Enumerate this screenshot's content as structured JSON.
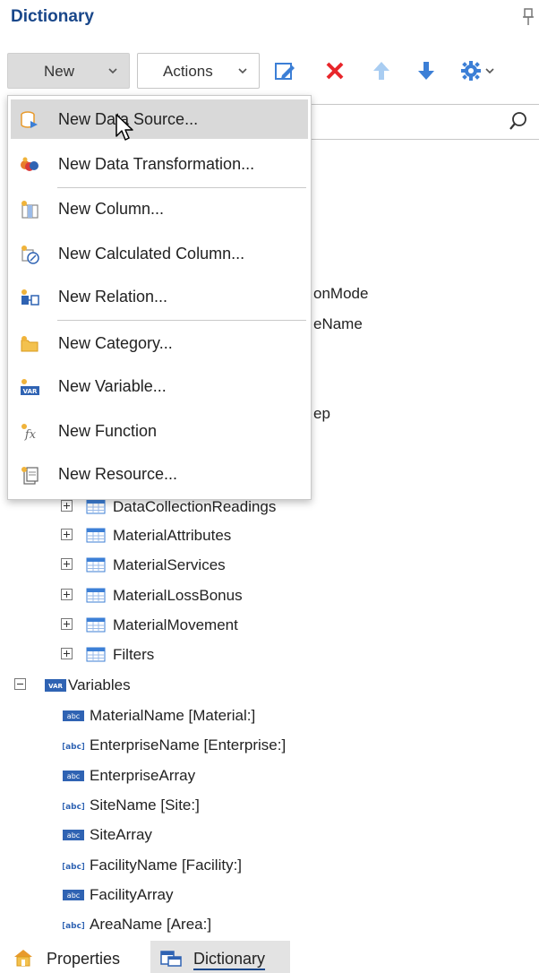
{
  "panel": {
    "title": "Dictionary"
  },
  "toolbar": {
    "new_label": "New",
    "actions_label": "Actions",
    "icons": [
      "edit-icon",
      "delete-icon",
      "move-up-icon",
      "move-down-icon",
      "settings-icon"
    ]
  },
  "menu": {
    "items": [
      {
        "label": "New Data Source...",
        "icon": "data-source-icon"
      },
      {
        "label": "New Data Transformation...",
        "icon": "data-transformation-icon"
      },
      {
        "label": "New Column...",
        "icon": "column-icon"
      },
      {
        "label": "New Calculated Column...",
        "icon": "calculated-column-icon"
      },
      {
        "label": "New Relation...",
        "icon": "relation-icon"
      },
      {
        "label": "New Category...",
        "icon": "category-icon"
      },
      {
        "label": "New Variable...",
        "icon": "variable-icon"
      },
      {
        "label": "New Function",
        "icon": "function-icon"
      },
      {
        "label": "New Resource...",
        "icon": "resource-icon"
      }
    ]
  },
  "tree": {
    "hidden_partials": [
      "onMode",
      "eName",
      "ep"
    ],
    "datasources": [
      "DataCollectionReadings",
      "MaterialAttributes",
      "MaterialServices",
      "MaterialLossBonus",
      "MaterialMovement",
      "Filters"
    ],
    "variables_label": "Variables",
    "variables": [
      {
        "label": "MaterialName [Material:]",
        "kind": "abc-array"
      },
      {
        "label": "EnterpriseName [Enterprise:]",
        "kind": "abc"
      },
      {
        "label": "EnterpriseArray",
        "kind": "abc-array"
      },
      {
        "label": "SiteName [Site:]",
        "kind": "abc"
      },
      {
        "label": "SiteArray",
        "kind": "abc-array"
      },
      {
        "label": "FacilityName [Facility:]",
        "kind": "abc"
      },
      {
        "label": "FacilityArray",
        "kind": "abc-array"
      },
      {
        "label": "AreaName [Area:]",
        "kind": "abc"
      }
    ]
  },
  "tabs": [
    {
      "label": "Properties",
      "icon": "properties-icon"
    },
    {
      "label": "Dictionary",
      "icon": "dictionary-icon",
      "active": true
    }
  ],
  "colors": {
    "title": "#19478a",
    "delete": "#e8262b",
    "arrow": "#3c7fd6",
    "arrow_disabled": "#a9cdf2"
  }
}
